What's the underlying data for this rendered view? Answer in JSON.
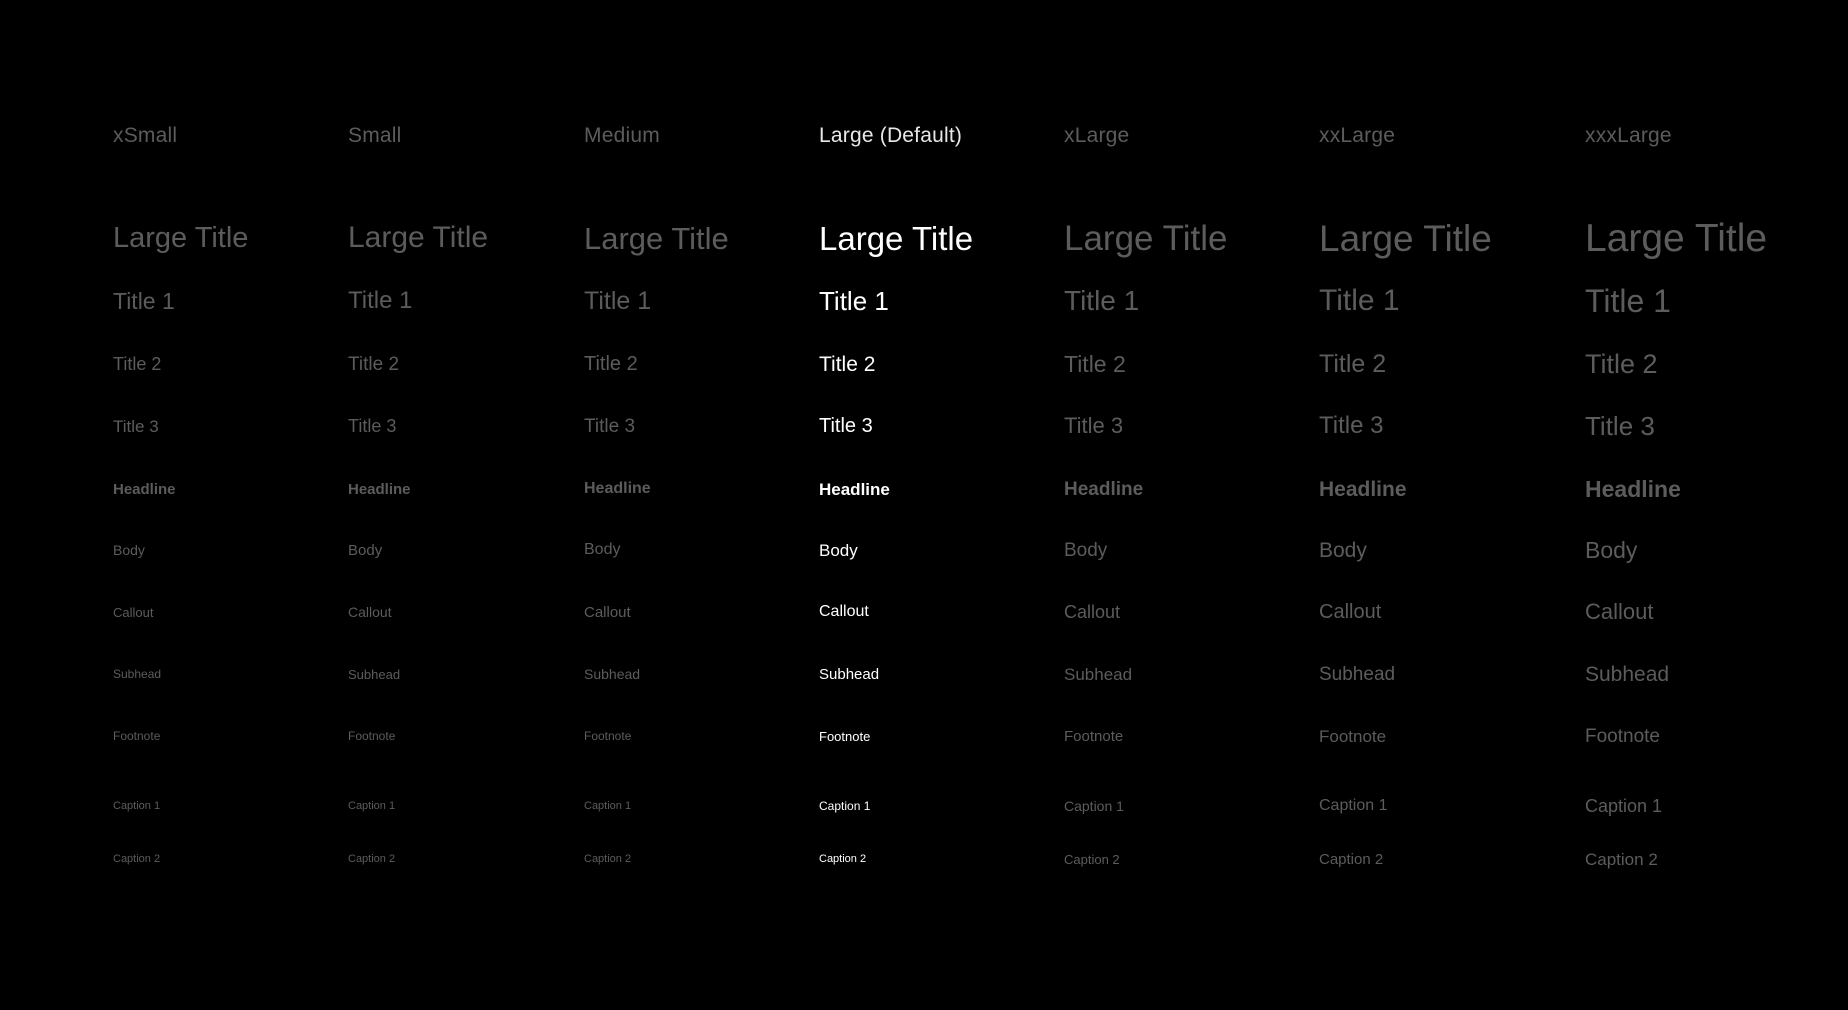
{
  "columns": [
    {
      "id": "xsmall",
      "header": "xSmall",
      "active": false,
      "styles": [
        "Large Title",
        "Title 1",
        "Title 2",
        "Title 3",
        "Headline",
        "Body",
        "Callout",
        "Subhead",
        "Footnote",
        "Caption 1",
        "Caption 2"
      ],
      "sizes": [
        29,
        23,
        18,
        17,
        15,
        14,
        13,
        12,
        12,
        11,
        11
      ]
    },
    {
      "id": "small",
      "header": "Small",
      "active": false,
      "styles": [
        "Large Title",
        "Title 1",
        "Title 2",
        "Title 3",
        "Headline",
        "Body",
        "Callout",
        "Subhead",
        "Footnote",
        "Caption 1",
        "Caption 2"
      ],
      "sizes": [
        30,
        24,
        19,
        18,
        15,
        15,
        14,
        13,
        12,
        11,
        11
      ]
    },
    {
      "id": "medium",
      "header": "Medium",
      "active": false,
      "styles": [
        "Large Title",
        "Title 1",
        "Title 2",
        "Title 3",
        "Headline",
        "Body",
        "Callout",
        "Subhead",
        "Footnote",
        "Caption 1",
        "Caption 2"
      ],
      "sizes": [
        31,
        25,
        20,
        19,
        16,
        16,
        15,
        14,
        12,
        11,
        11
      ]
    },
    {
      "id": "large",
      "header": "Large (Default)",
      "active": true,
      "styles": [
        "Large Title",
        "Title 1",
        "Title 2",
        "Title 3",
        "Headline",
        "Body",
        "Callout",
        "Subhead",
        "Footnote",
        "Caption 1",
        "Caption 2"
      ],
      "sizes": [
        33,
        26,
        21,
        20,
        17,
        17,
        16,
        15,
        13,
        12,
        11
      ]
    },
    {
      "id": "xlarge",
      "header": "xLarge",
      "active": false,
      "styles": [
        "Large Title",
        "Title 1",
        "Title 2",
        "Title 3",
        "Headline",
        "Body",
        "Callout",
        "Subhead",
        "Footnote",
        "Caption 1",
        "Caption 2"
      ],
      "sizes": [
        35,
        28,
        23,
        22,
        19,
        19,
        18,
        17,
        15,
        14,
        13
      ]
    },
    {
      "id": "xxlarge",
      "header": "xxLarge",
      "active": false,
      "styles": [
        "Large Title",
        "Title 1",
        "Title 2",
        "Title 3",
        "Headline",
        "Body",
        "Callout",
        "Subhead",
        "Footnote",
        "Caption 1",
        "Caption 2"
      ],
      "sizes": [
        37,
        30,
        25,
        24,
        21,
        21,
        20,
        19,
        17,
        16,
        15
      ]
    },
    {
      "id": "xxxlarge",
      "header": "xxxLarge",
      "active": false,
      "styles": [
        "Large Title",
        "Title 1",
        "Title 2",
        "Title 3",
        "Headline",
        "Body",
        "Callout",
        "Subhead",
        "Footnote",
        "Caption 1",
        "Caption 2"
      ],
      "sizes": [
        39,
        32,
        27,
        26,
        23,
        23,
        22,
        21,
        19,
        18,
        17
      ]
    }
  ],
  "colors": {
    "background": "#000000",
    "dim_text": "#5c5c5c",
    "active_text": "#ffffff"
  }
}
